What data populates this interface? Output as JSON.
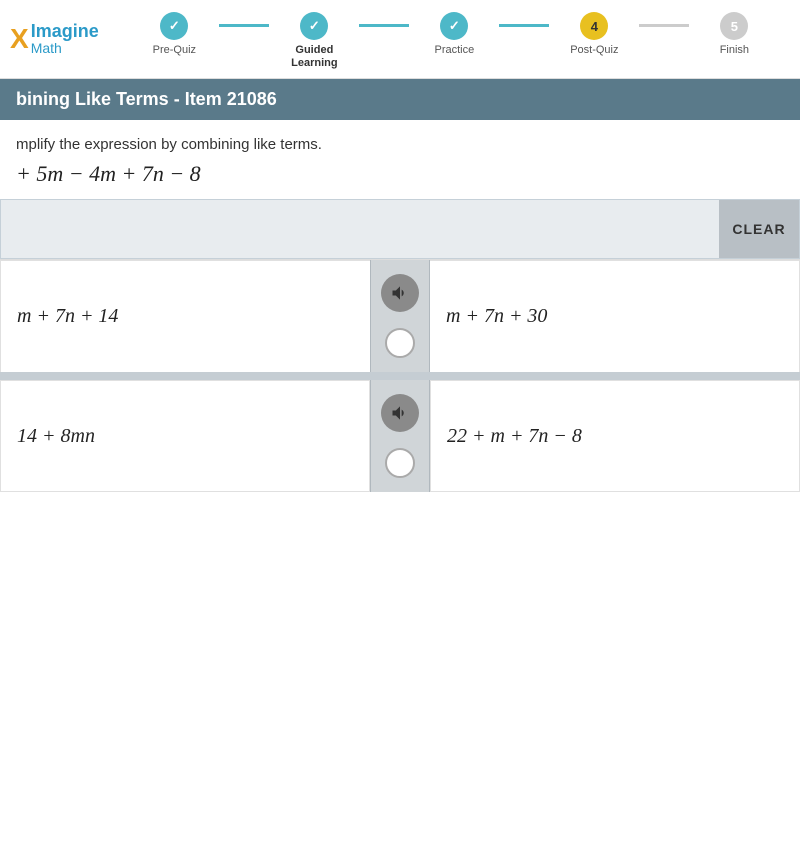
{
  "logo": {
    "x_char": "X",
    "imagine": "Imagine",
    "math": "Math"
  },
  "steps": [
    {
      "label": "Pre-Quiz",
      "state": "completed",
      "number": "✓"
    },
    {
      "label": "Guided\nLearning",
      "state": "active",
      "number": ""
    },
    {
      "label": "Practice",
      "state": "completed",
      "number": "✓"
    },
    {
      "label": "Post-Quiz",
      "state": "active",
      "number": "4"
    },
    {
      "label": "Finish",
      "state": "inactive",
      "number": "5"
    }
  ],
  "title": "bining Like Terms - Item 21086",
  "instruction": "mplify the expression by combining like terms.",
  "expression": "+ 5m − 4m + 7n − 8",
  "clear_button": "CLEAR",
  "options": [
    {
      "id": "A",
      "text": "m + 7n + 14"
    },
    {
      "id": "B",
      "text": "m + 7n + 30"
    },
    {
      "id": "C",
      "text": "14 + 8mn"
    },
    {
      "id": "D",
      "text": "22 + m + 7n − 8"
    }
  ]
}
